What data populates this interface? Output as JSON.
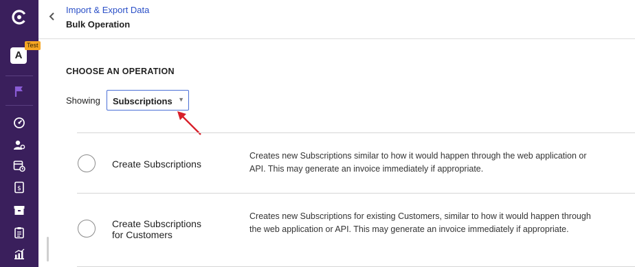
{
  "sidebar": {
    "avatar_letter": "A",
    "test_badge": "Test",
    "icons": [
      "logo-icon",
      "flag-icon",
      "dashboard-icon",
      "customers-icon",
      "subscriptions-icon",
      "invoices-icon",
      "products-icon",
      "reports-icon",
      "analytics-icon"
    ]
  },
  "header": {
    "breadcrumb": "Import & Export Data",
    "title": "Bulk Operation"
  },
  "main": {
    "section_heading": "CHOOSE AN OPERATION",
    "showing_label": "Showing",
    "filter_select": {
      "value": "Subscriptions"
    },
    "operations": [
      {
        "name": "Create Subscriptions",
        "description": "Creates new Subscriptions similar to how it would happen through the web application or API. This may generate an invoice immediately if appropriate."
      },
      {
        "name": "Create Subscriptions for Customers",
        "description": "Creates new Subscriptions for existing Customers, similar to how it would happen through the web application or API. This may generate an invoice immediately if appropriate."
      }
    ]
  },
  "colors": {
    "sidebar_bg": "#3a1f5c",
    "link": "#2a4fc7",
    "select_border": "#4a6fd6",
    "annotation_arrow": "#d8202a",
    "test_badge": "#f5a623"
  }
}
